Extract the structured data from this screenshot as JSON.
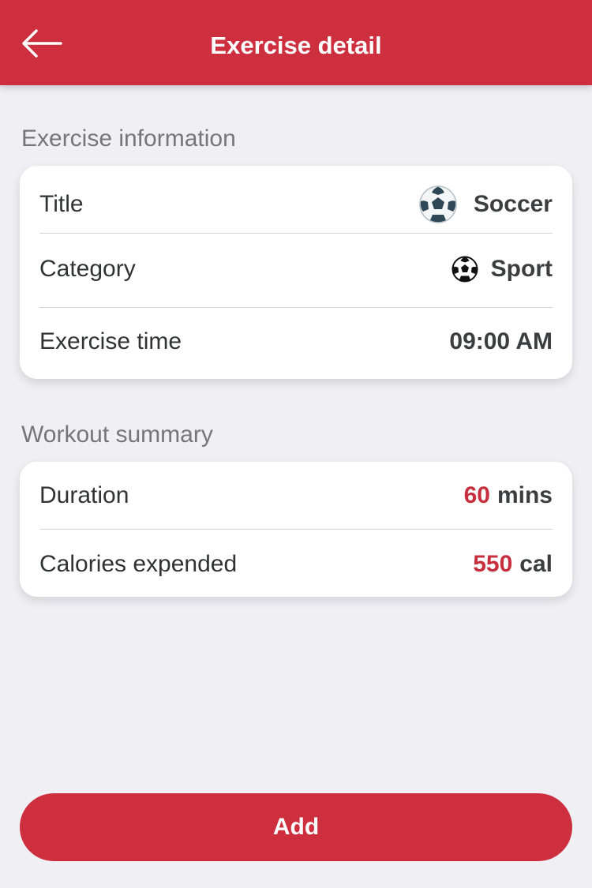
{
  "header": {
    "title": "Exercise detail",
    "back_icon": "arrow-left-icon",
    "color": "#cd2f3f"
  },
  "exercise_information": {
    "section_title": "Exercise information",
    "title_label": "Title",
    "title_value": "Soccer",
    "title_icon": "soccer-ball-icon",
    "category_label": "Category",
    "category_value": "Sport",
    "category_icon": "soccer-ball-icon",
    "time_label": "Exercise time",
    "time_value": "09:00 AM"
  },
  "workout_summary": {
    "section_title": "Workout summary",
    "duration_label": "Duration",
    "duration_value": "60",
    "duration_unit": "mins",
    "calories_label": "Calories expended",
    "calories_value": "550",
    "calories_unit": "cal",
    "accent_color": "#c72f3f"
  },
  "footer": {
    "add_label": "Add"
  }
}
